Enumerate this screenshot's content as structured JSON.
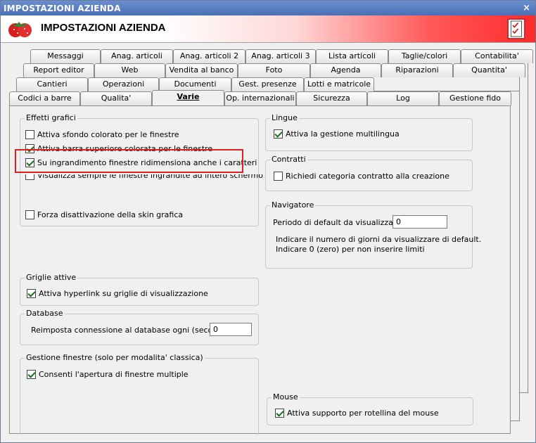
{
  "window": {
    "title": "IMPOSTAZIONI AZIENDA",
    "close_glyph": "×"
  },
  "banner": {
    "title": "IMPOSTAZIONI AZIENDA",
    "logo_icon": "strawberry-icon",
    "right_icon": "checklist-icon"
  },
  "tabs": {
    "row1": [
      "Messaggi",
      "Anag. articoli",
      "Anag. articoli 2",
      "Anag. articoli 3",
      "Lista articoli",
      "Taglie/colori",
      "Contabilita'"
    ],
    "row2": [
      "Report editor",
      "Web",
      "Vendita al banco",
      "Foto",
      "Agenda",
      "Riparazioni",
      "Quantita'"
    ],
    "row3": [
      "Cantieri",
      "Operazioni",
      "Documenti",
      "Gest. presenze",
      "Lotti e matricole"
    ],
    "row4": [
      "Codici a barre",
      "Qualita'",
      "Varie",
      "Op. internazionali",
      "Sicurezza",
      "Log",
      "Gestione fido"
    ]
  },
  "effetti": {
    "legend": "Effetti grafici",
    "opt1": "Attiva sfondo colorato per le finestre",
    "opt2": "Attiva barra superiore colorata per le finestre",
    "opt3": "Su ingrandimento finestre ridimensiona anche i caratteri",
    "opt4": "Visualizza sempre le finestre ingrandite ad intero schermo",
    "opt5": "Forza disattivazione della skin grafica"
  },
  "lingue": {
    "legend": "Lingue",
    "opt": "Attiva la gestione multilingua"
  },
  "contratti": {
    "legend": "Contratti",
    "opt": "Richiedi categoria contratto alla creazione"
  },
  "navigatore": {
    "legend": "Navigatore",
    "label": "Periodo di default da visualizzare :",
    "value": "0",
    "hint1": "Indicare il numero di giorni da visualizzare di default.",
    "hint2": "Indicare 0 (zero) per non inserire limiti"
  },
  "griglie": {
    "legend": "Griglie attive",
    "opt": "Attiva hyperlink su griglie di visualizzazione"
  },
  "database": {
    "legend": "Database",
    "label": "Reimposta connessione al database ogni (secondi) :",
    "value": "0"
  },
  "gestione": {
    "legend": "Gestione finestre (solo per modalita' classica)",
    "opt": "Consenti l'apertura di finestre multiple"
  },
  "mouse": {
    "legend": "Mouse",
    "opt": "Attiva supporto per rotellina del mouse"
  },
  "colors": {
    "highlight": "#e02020",
    "title_bar": "#5a7fc2"
  }
}
